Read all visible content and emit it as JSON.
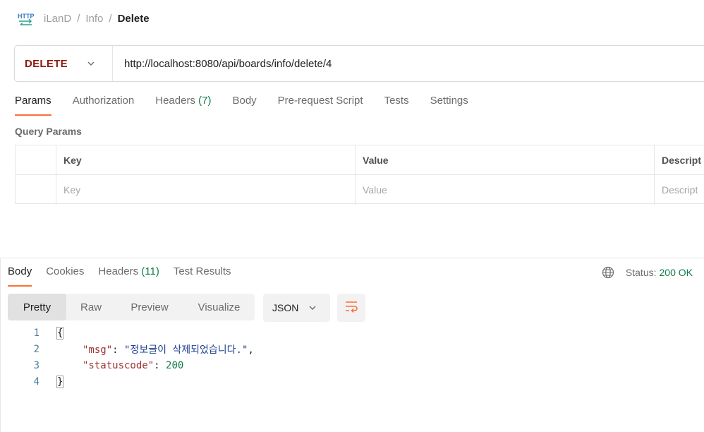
{
  "breadcrumb": {
    "icon": "http-icon",
    "items": [
      "iLanD",
      "Info"
    ],
    "current": "Delete"
  },
  "request": {
    "method": "DELETE",
    "url": "http://localhost:8080/api/boards/info/delete/4"
  },
  "request_tabs": [
    {
      "label": "Params"
    },
    {
      "label": "Authorization"
    },
    {
      "label": "Headers",
      "count": "(7)"
    },
    {
      "label": "Body"
    },
    {
      "label": "Pre-request Script"
    },
    {
      "label": "Tests"
    },
    {
      "label": "Settings"
    }
  ],
  "query_params": {
    "title": "Query Params",
    "headers": [
      "Key",
      "Value",
      "Descript"
    ],
    "placeholders": [
      "Key",
      "Value",
      "Descript"
    ]
  },
  "response_tabs": [
    {
      "label": "Body"
    },
    {
      "label": "Cookies"
    },
    {
      "label": "Headers",
      "count": "(11)"
    },
    {
      "label": "Test Results"
    }
  ],
  "status": {
    "label": "Status:",
    "value": "200 OK"
  },
  "view_modes": [
    "Pretty",
    "Raw",
    "Preview",
    "Visualize"
  ],
  "format": "JSON",
  "code_lines": [
    {
      "n": "1",
      "text": "{"
    },
    {
      "n": "2",
      "key": "\"msg\"",
      "value": "\"정보글이 삭제되었습니다.\""
    },
    {
      "n": "3",
      "key": "\"statuscode\"",
      "value": "200"
    },
    {
      "n": "4",
      "text": "}"
    }
  ],
  "colors": {
    "accent": "#ff6c37",
    "method": "#8e1a10",
    "success": "#0f7b4a"
  }
}
